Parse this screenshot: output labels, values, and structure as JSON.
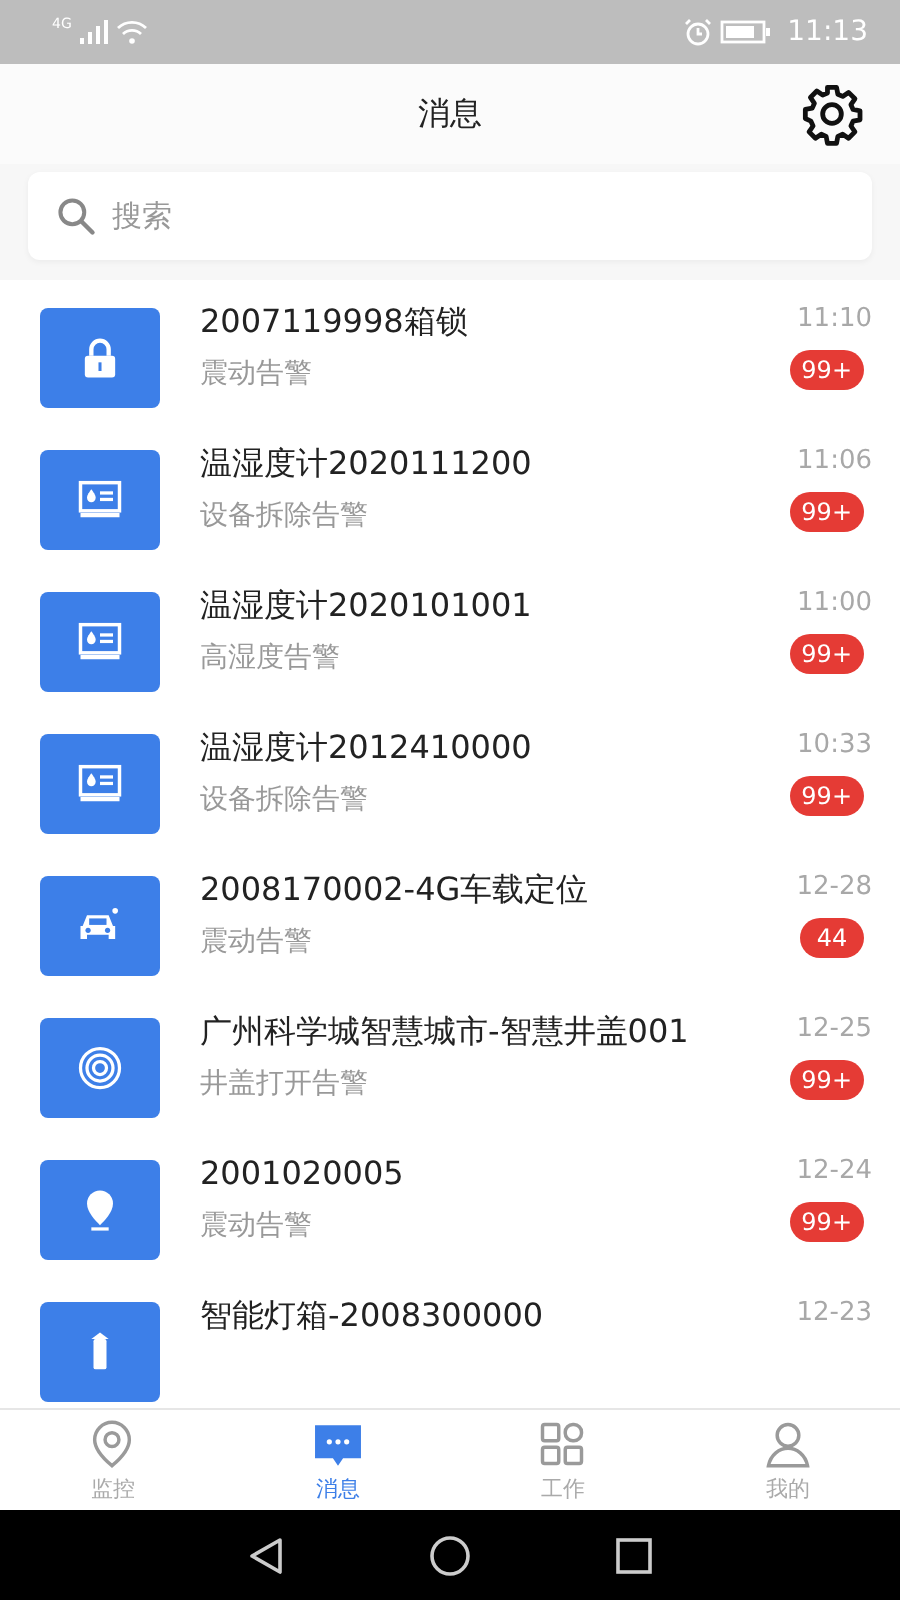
{
  "status_bar": {
    "network": "4G",
    "time": "11:13"
  },
  "header": {
    "title": "消息"
  },
  "search": {
    "placeholder": "搜索"
  },
  "messages": [
    {
      "kind": "lock",
      "title": "2007119998箱锁",
      "subtitle": "震动告警",
      "time": "11:10",
      "badge": "99+"
    },
    {
      "kind": "thermometer",
      "title": "温湿度计2020111200",
      "subtitle": "设备拆除告警",
      "time": "11:06",
      "badge": "99+"
    },
    {
      "kind": "thermometer",
      "title": "温湿度计2020101001",
      "subtitle": "高湿度告警",
      "time": "11:00",
      "badge": "99+"
    },
    {
      "kind": "thermometer",
      "title": "温湿度计2012410000",
      "subtitle": "设备拆除告警",
      "time": "10:33",
      "badge": "99+"
    },
    {
      "kind": "car",
      "title": "2008170002-4G车载定位",
      "subtitle": "震动告警",
      "time": "12-28",
      "badge": "44"
    },
    {
      "kind": "manhole",
      "title": "广州科学城智慧城市-智慧井盖001",
      "subtitle": "井盖打开告警",
      "time": "12-25",
      "badge": "99+"
    },
    {
      "kind": "pin",
      "title": "2001020005",
      "subtitle": "震动告警",
      "time": "12-24",
      "badge": "99+"
    },
    {
      "kind": "lamp",
      "title": "智能灯箱-2008300000",
      "time": "12-23"
    }
  ],
  "tabs": [
    {
      "kind": "monitor",
      "label": "监控",
      "selected": false
    },
    {
      "kind": "message",
      "label": "消息",
      "selected": true
    },
    {
      "kind": "work",
      "label": "工作",
      "selected": false
    },
    {
      "kind": "profile",
      "label": "我的",
      "selected": false
    }
  ]
}
